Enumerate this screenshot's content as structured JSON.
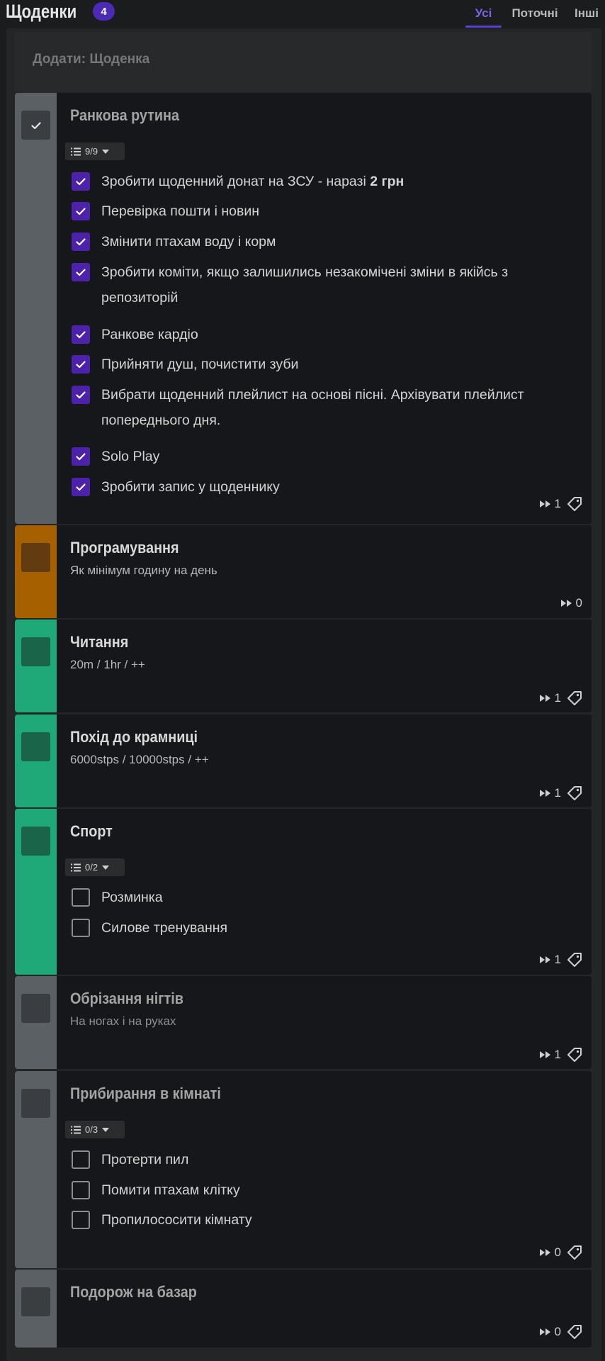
{
  "header": {
    "title": "Щоденки",
    "count": "4",
    "tabs": [
      "Усі",
      "Поточні",
      "Інші"
    ],
    "active_tab": "Усі"
  },
  "add_bar": {
    "placeholder": "Додати: Щоденка"
  },
  "tasks": [
    {
      "title": "Ранкова рутина",
      "color": "gray",
      "completed": true,
      "checklist_count": "9/9",
      "checklist": [
        {
          "text": "Зробити щоденний донат на ЗСУ - наразі ",
          "bold": "2 грн",
          "done": true
        },
        {
          "text": "Перевірка пошти і новин",
          "done": true
        },
        {
          "text": "Змінити птахам воду і корм",
          "done": true
        },
        {
          "text": "Зробити коміти, якщо залишились незакомічені зміни в якійсь з репозиторій",
          "done": true
        },
        {
          "text": "Ранкове кардіо",
          "done": true
        },
        {
          "text": "Прийняти душ, почистити зуби",
          "done": true
        },
        {
          "text": "Вибрати щоденний плейлист на основі пісні. Архівувати плейлист попереднього дня.",
          "done": true
        },
        {
          "text": "Solo Play",
          "done": true
        },
        {
          "text": "Зробити запис у щоденнику",
          "done": true
        }
      ],
      "streak": "1",
      "has_tag_icon": true
    },
    {
      "title": "Програмування",
      "notes": "Як мінімум годину на день",
      "color": "orange",
      "streak": "0",
      "has_tag_icon": false
    },
    {
      "title": "Читання",
      "notes": "20m / 1hr / ++",
      "color": "green",
      "streak": "1",
      "has_tag_icon": true
    },
    {
      "title": "Похід до крамниці",
      "notes": "6000stps / 10000stps / ++",
      "color": "green",
      "streak": "1",
      "has_tag_icon": true
    },
    {
      "title": "Спорт",
      "color": "green",
      "checklist_count": "0/2",
      "checklist": [
        {
          "text": "Розминка",
          "done": false
        },
        {
          "text": "Силове тренування",
          "done": false
        }
      ],
      "streak": "1",
      "has_tag_icon": true
    },
    {
      "title": "Обрізання нігтів",
      "notes": "На ногах і на руках",
      "color": "gray",
      "streak": "1",
      "has_tag_icon": true
    },
    {
      "title": "Прибирання в кімнаті",
      "color": "gray",
      "checklist_count": "0/3",
      "checklist": [
        {
          "text": "Протерти пил",
          "done": false
        },
        {
          "text": "Помити птахам клітку",
          "done": false
        },
        {
          "text": "Пропилососити кімнату",
          "done": false
        }
      ],
      "streak": "0",
      "has_tag_icon": true
    },
    {
      "title": "Подорож на базар",
      "color": "gray",
      "streak": "0",
      "has_tag_icon": true
    }
  ],
  "colors": {
    "accent": "#4b2ab8",
    "gray": "#5b6064",
    "orange": "#a76000",
    "green": "#1fa878",
    "card": "#16171a"
  }
}
